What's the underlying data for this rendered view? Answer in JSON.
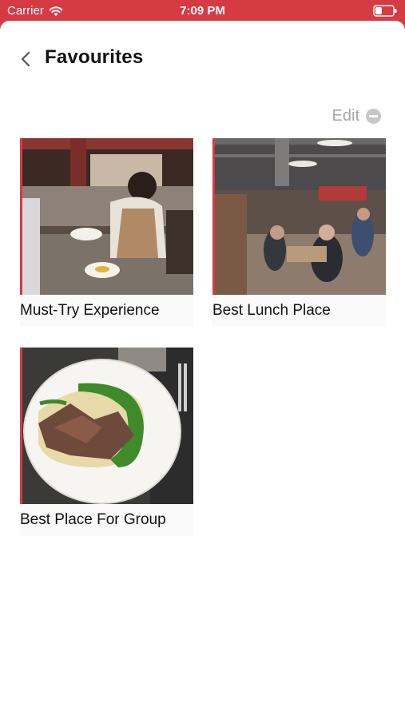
{
  "status_bar": {
    "carrier": "Carrier",
    "time": "7:09 PM"
  },
  "header": {
    "title": "Favourites",
    "back_icon": "chevron-left-icon"
  },
  "edit": {
    "label": "Edit",
    "icon": "minus-circle-icon"
  },
  "favourites": [
    {
      "title": "Must-Try Experience"
    },
    {
      "title": "Best Lunch Place"
    },
    {
      "title": "Best Place For Group"
    }
  ],
  "colors": {
    "brand": "#d63b44",
    "edit_gray": "#a7a7a7"
  }
}
